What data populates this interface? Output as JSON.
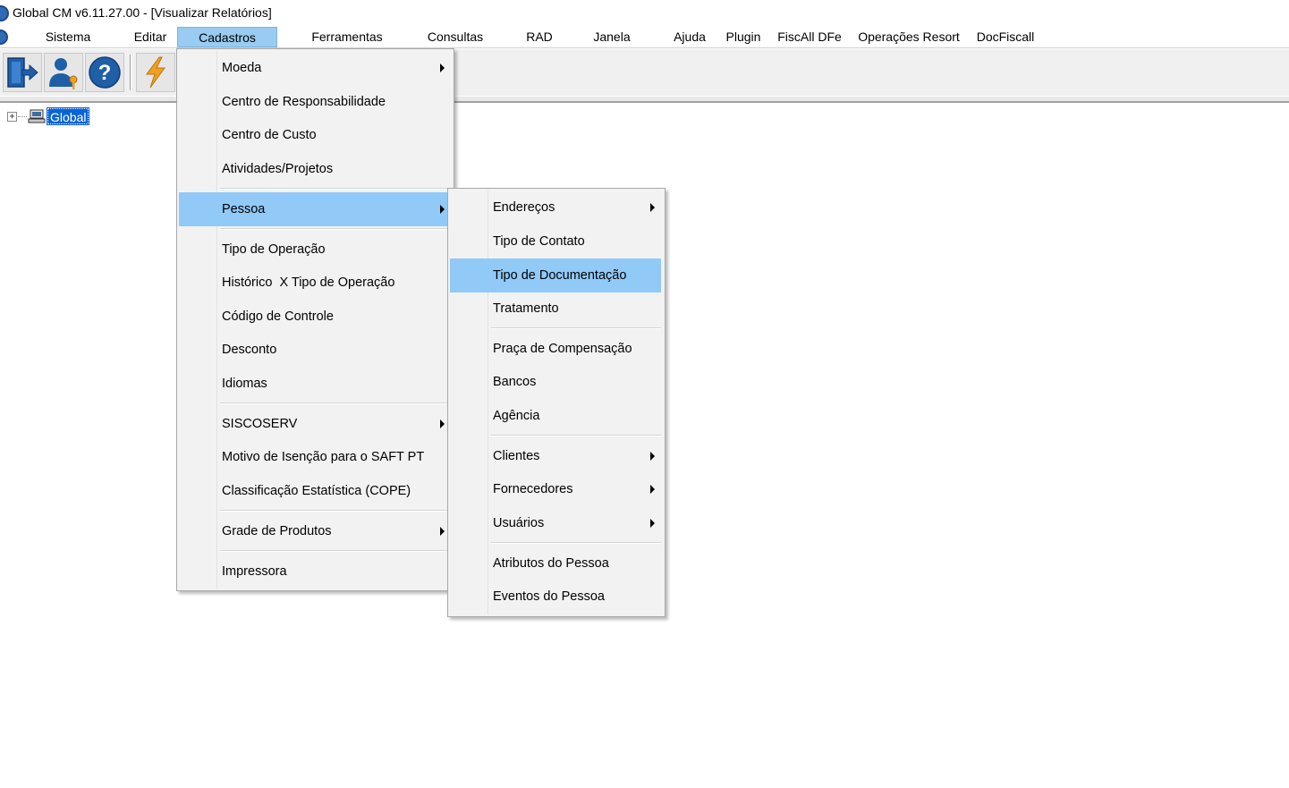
{
  "window": {
    "title": "Global CM v6.11.27.00 - [Visualizar Relatórios]"
  },
  "menubar": {
    "items": [
      {
        "label": "Sistema"
      },
      {
        "label": "Editar"
      },
      {
        "label": "Cadastros",
        "active": true
      },
      {
        "label": "Ferramentas"
      },
      {
        "label": "Consultas"
      },
      {
        "label": "RAD"
      },
      {
        "label": "Janela"
      },
      {
        "label": "Ajuda"
      },
      {
        "label": "Plugin"
      },
      {
        "label": "FiscAll DFe"
      },
      {
        "label": "Operações Resort"
      },
      {
        "label": "DocFiscall"
      }
    ]
  },
  "toolbar": {
    "buttons": [
      {
        "icon": "exit-door-icon"
      },
      {
        "icon": "user-key-icon"
      },
      {
        "icon": "help-question-icon"
      },
      {
        "icon": "lightning-icon"
      }
    ],
    "colors": {
      "blue": "#1f5fa8",
      "orange": "#f0a020"
    }
  },
  "tree": {
    "root_label": "Global",
    "expander": "+"
  },
  "cadastros_menu": {
    "items": [
      {
        "label": "Moeda",
        "submenu": true
      },
      {
        "label": "Centro de Responsabilidade"
      },
      {
        "label": "Centro de Custo"
      },
      {
        "label": "Atividades/Projetos"
      },
      {
        "label": "Pessoa",
        "submenu": true,
        "highlighted": true
      },
      {
        "label": "Tipo de Operação"
      },
      {
        "label": "Histórico  X Tipo de Operação"
      },
      {
        "label": "Código de Controle"
      },
      {
        "label": "Desconto"
      },
      {
        "label": "Idiomas"
      },
      {
        "label": "SISCOSERV",
        "submenu": true
      },
      {
        "label": "Motivo de Isenção para o SAFT PT"
      },
      {
        "label": "Classificação Estatística (COPE)"
      },
      {
        "label": "Grade de Produtos",
        "submenu": true
      },
      {
        "label": "Impressora"
      }
    ]
  },
  "pessoa_menu": {
    "items": [
      {
        "label": "Endereços",
        "submenu": true
      },
      {
        "label": "Tipo de Contato"
      },
      {
        "label": "Tipo de Documentação",
        "highlighted": true
      },
      {
        "label": "Tratamento"
      },
      {
        "label": "Praça de Compensação"
      },
      {
        "label": "Bancos"
      },
      {
        "label": "Agência"
      },
      {
        "label": "Clientes",
        "submenu": true
      },
      {
        "label": "Fornecedores",
        "submenu": true
      },
      {
        "label": "Usuários",
        "submenu": true
      },
      {
        "label": "Atributos do Pessoa"
      },
      {
        "label": "Eventos do Pessoa"
      }
    ]
  },
  "colors": {
    "menu_highlight": "#91c9f7",
    "menubar_active": "#99ccf0",
    "tree_selection": "#0a64d6"
  }
}
